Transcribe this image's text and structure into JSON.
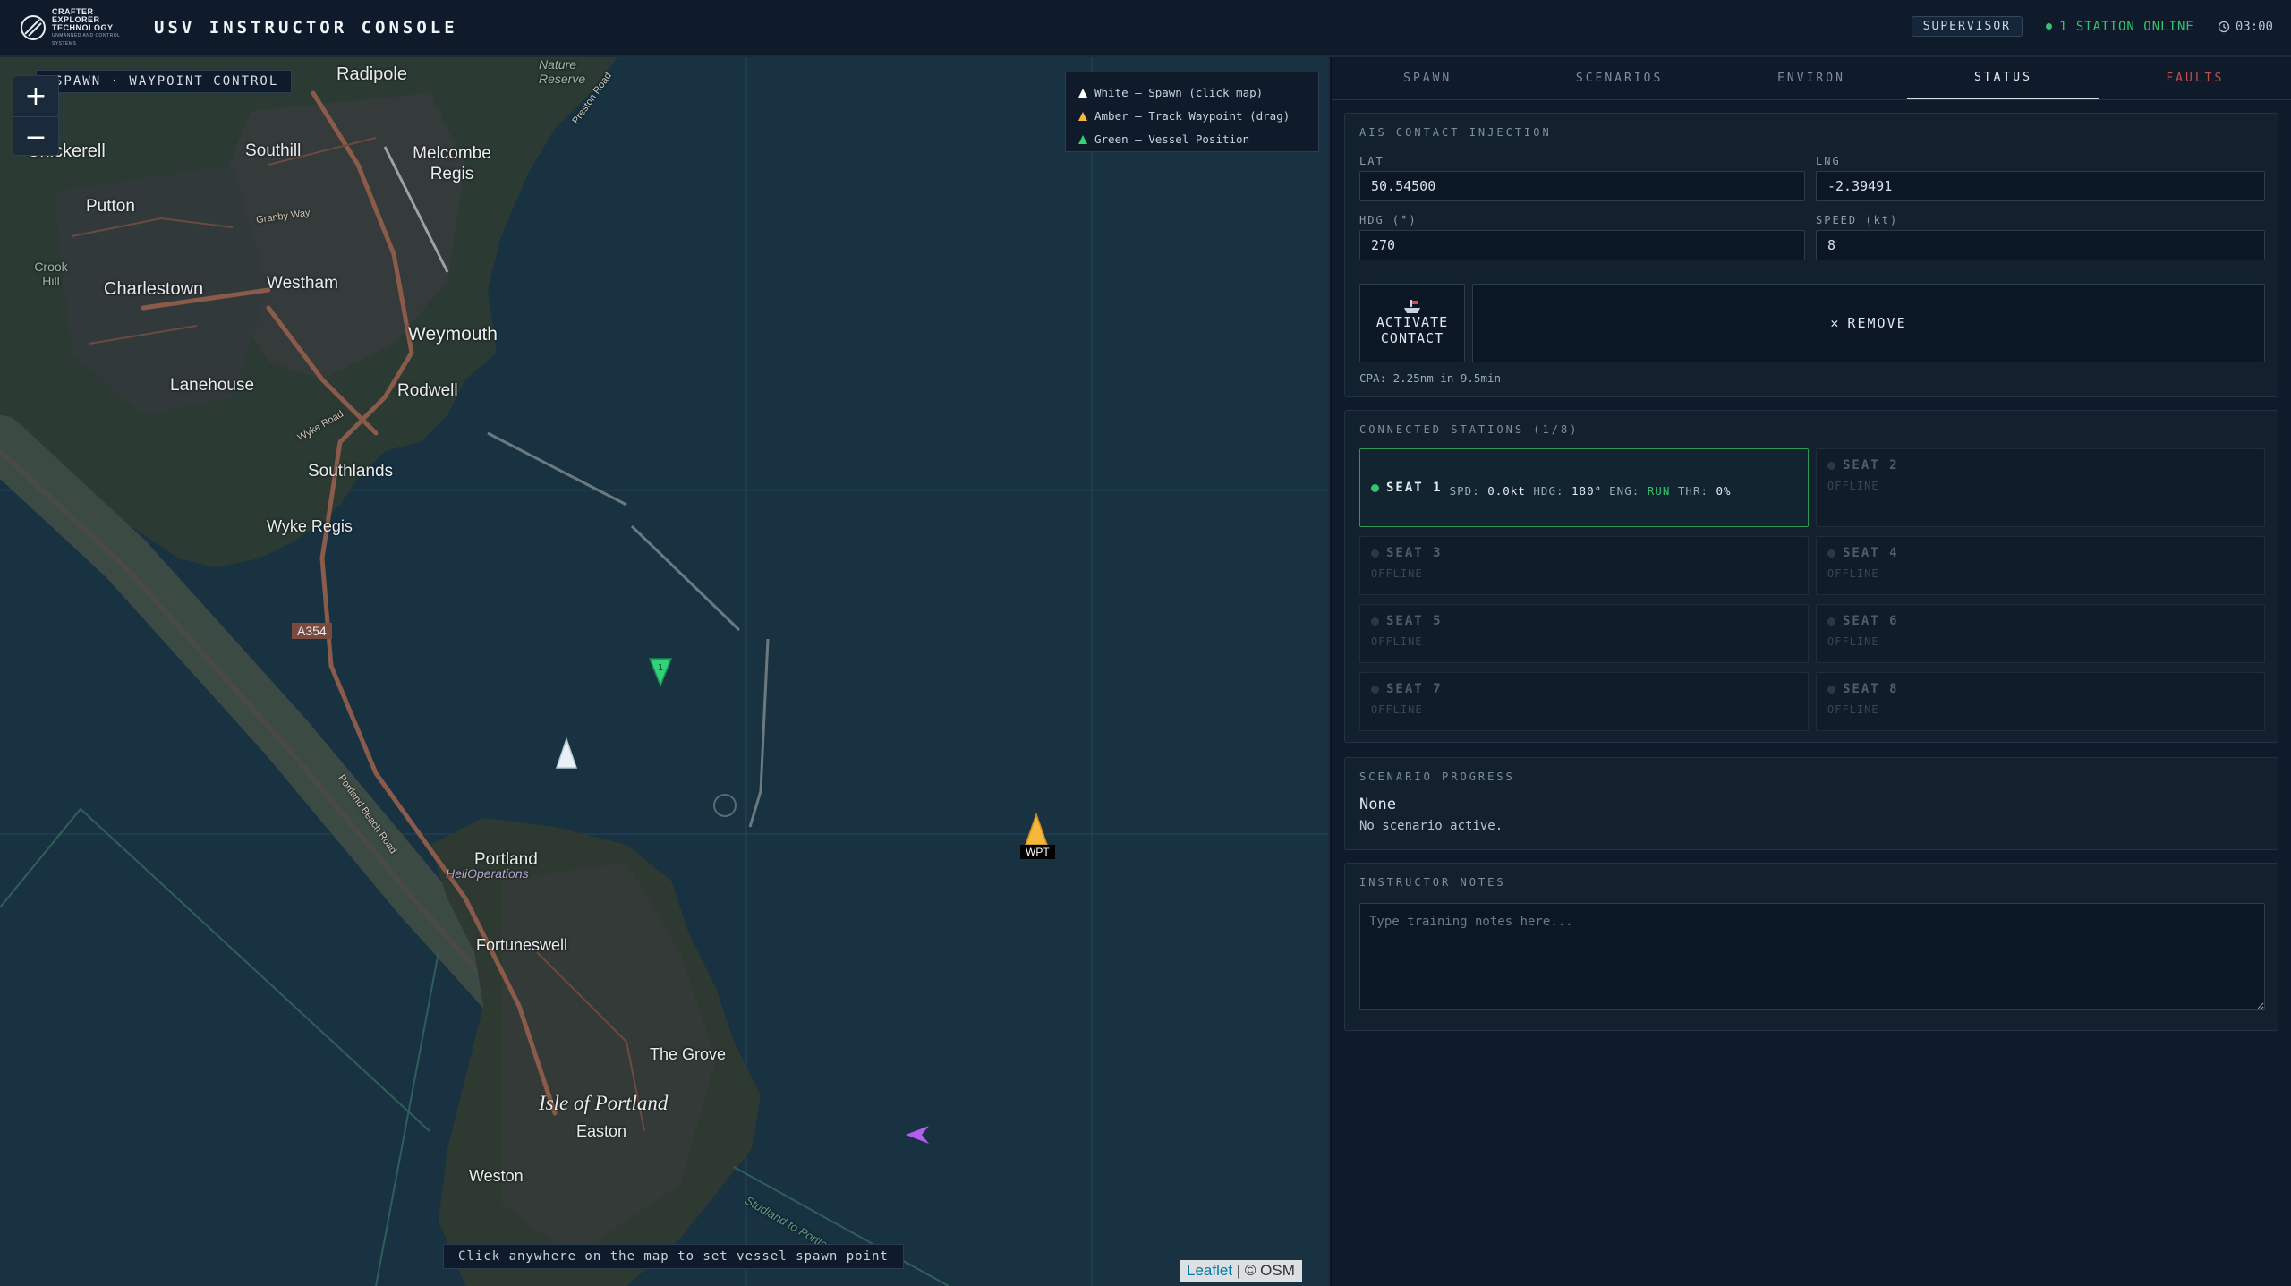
{
  "header": {
    "logo_line1": "CRAFTER",
    "logo_line2": "EXPLORER",
    "logo_line3": "TECHNOLOGY",
    "logo_tagline": "UNMANNED AND CONTROL SYSTEMS",
    "title": "USV INSTRUCTOR CONSOLE",
    "role": "SUPERVISOR",
    "online_status": "1 STATION ONLINE",
    "clock": "03:00"
  },
  "map": {
    "mode_label": "SPAWN · WAYPOINT CONTROL",
    "zoom_in": "+",
    "zoom_out": "−",
    "legend": [
      {
        "text": "White — Spawn (click map)",
        "color": "#ffffff"
      },
      {
        "text": "Amber — Track Waypoint (drag)",
        "color": "#f5b83d"
      },
      {
        "text": "Green — Vessel Position",
        "color": "#2fd37a"
      }
    ],
    "hint": "Click anywhere on the map to set vessel spawn point",
    "attribution_leaflet": "Leaflet",
    "attribution_osm": "| © OSM",
    "waypoint_label": "WPT",
    "vessel_number": "1",
    "places": {
      "radipole": "Radipole",
      "nature_reserve": "Nature Reserve",
      "preston_road": "Preston Road",
      "chickerell": "Chickerell",
      "southill": "Southill",
      "melcombe_regis": "Melcombe Regis",
      "putton": "Putton",
      "granby_way": "Granby Way",
      "crook_hill": "Crook Hill",
      "charlestown": "Charlestown",
      "westham": "Westham",
      "weymouth": "Weymouth",
      "lanehouse": "Lanehouse",
      "rodwell": "Rodwell",
      "wyke_road": "Wyke Road",
      "southlands": "Southlands",
      "wyke_regis": "Wyke Regis",
      "a354": "A354",
      "portland_beach_road": "Portland Beach Road",
      "portland": "Portland",
      "heli_operations": "HeliOperations",
      "fortuneswell": "Fortuneswell",
      "the_grove": "The Grove",
      "isle_of_portland": "Isle of Portland",
      "easton": "Easton",
      "weston": "Weston",
      "studland_to_portland": "Studland to Portland"
    }
  },
  "tabs": [
    {
      "label": "SPAWN"
    },
    {
      "label": "SCENARIOS"
    },
    {
      "label": "ENVIRON"
    },
    {
      "label": "STATUS"
    },
    {
      "label": "FAULTS"
    }
  ],
  "ais": {
    "title": "AIS CONTACT INJECTION",
    "lat_label": "LAT",
    "lat_value": "50.54500",
    "lng_label": "LNG",
    "lng_value": "-2.39491",
    "hdg_label": "HDG (°)",
    "hdg_value": "270",
    "speed_label": "SPEED (kt)",
    "speed_value": "8",
    "activate_label_1": "ACTIVATE",
    "activate_label_2": "CONTACT",
    "remove_label": "REMOVE",
    "cpa": "CPA: 2.25nm in 9.5min"
  },
  "stations": {
    "title": "CONNECTED STATIONS (1/8)",
    "seat1": {
      "name": "SEAT 1",
      "spd_label": "SPD:",
      "spd": "0.0kt",
      "hdg_label": "HDG:",
      "hdg": "180°",
      "eng_label": "ENG:",
      "eng": "RUN",
      "thr_label": "THR:",
      "thr": "0%"
    },
    "offline_seats": [
      {
        "name": "SEAT 2",
        "status": "OFFLINE"
      },
      {
        "name": "SEAT 3",
        "status": "OFFLINE"
      },
      {
        "name": "SEAT 4",
        "status": "OFFLINE"
      },
      {
        "name": "SEAT 5",
        "status": "OFFLINE"
      },
      {
        "name": "SEAT 6",
        "status": "OFFLINE"
      },
      {
        "name": "SEAT 7",
        "status": "OFFLINE"
      },
      {
        "name": "SEAT 8",
        "status": "OFFLINE"
      }
    ]
  },
  "scenario": {
    "title": "SCENARIO PROGRESS",
    "name": "None",
    "status": "No scenario active."
  },
  "notes": {
    "title": "INSTRUCTOR NOTES",
    "placeholder": "Type training notes here..."
  },
  "colors": {
    "accent_green": "#35c46e",
    "amber": "#f5b83d",
    "faults_red": "#c0504a",
    "ais_contact": "#b45cf0"
  }
}
